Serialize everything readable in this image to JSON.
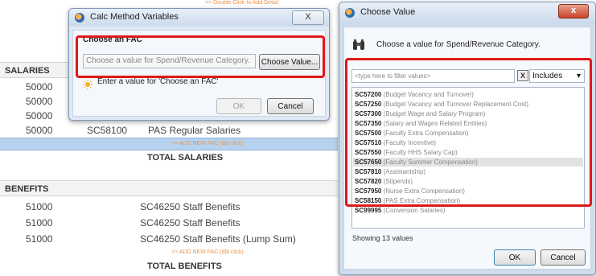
{
  "sheet": {
    "top_hint": ">> Double Click to Add Detail",
    "salaries_header": "SALARIES",
    "salary_rows": [
      {
        "acct": "50000",
        "code": "",
        "desc": ""
      },
      {
        "acct": "50000",
        "code": "",
        "desc": ""
      },
      {
        "acct": "50000",
        "code": "",
        "desc": ""
      },
      {
        "acct": "50000",
        "code": "SC58100",
        "desc": "PAS Regular Salaries"
      }
    ],
    "add_new_fac": ">> ADD NEW FAC (dbl click)",
    "total_salaries": "TOTAL SALARIES",
    "benefits_header": "BENEFITS",
    "benefit_rows": [
      {
        "acct": "51000",
        "text": "SC46250 Staff Benefits"
      },
      {
        "acct": "51000",
        "text": "SC46250 Staff Benefits"
      },
      {
        "acct": "51000",
        "text": "SC46250 Staff Benefits (Lump Sum)"
      }
    ],
    "add_new_fac_2": ">> ADD NEW FAC (dbl click)",
    "total_benefits": "TOTAL BENEFITS"
  },
  "calc_dialog": {
    "title": "Calc Method Variables",
    "close": "X",
    "field_label": "Choose an FAC",
    "field_placeholder": "Choose a value for Spend/Revenue Category.",
    "choose_button": "Choose Value...",
    "hint": "Enter a value for 'Choose an FAC'",
    "ok": "OK",
    "cancel": "Cancel"
  },
  "choose_dialog": {
    "title": "Choose Value",
    "close": "x",
    "instruction": "Choose a value for Spend/Revenue Category.",
    "filter_placeholder": "<type here to filter values>",
    "clear": "X",
    "match_mode": "Includes",
    "items": [
      {
        "code": "SC57200",
        "desc": "(Budget Vacancy and Turnover)"
      },
      {
        "code": "SC57250",
        "desc": "(Budget Vacancy and Turnover Replacement Cost)"
      },
      {
        "code": "SC57300",
        "desc": "(Budget Wage and Salary Program)"
      },
      {
        "code": "SC57350",
        "desc": "(Salary and Wages Related Entities)"
      },
      {
        "code": "SC57500",
        "desc": "(Faculty Extra Compensation)"
      },
      {
        "code": "SC57510",
        "desc": "(Faculty Incentive)"
      },
      {
        "code": "SC57550",
        "desc": "(Faculty HHS Salary Cap)"
      },
      {
        "code": "SC57650",
        "desc": "(Faculty Summer Compensation)"
      },
      {
        "code": "SC57810",
        "desc": "(Assistantship)"
      },
      {
        "code": "SC57820",
        "desc": "(Stipends)"
      },
      {
        "code": "SC57950",
        "desc": "(Nurse Extra Compensation)"
      },
      {
        "code": "SC58150",
        "desc": "(PAS Extra Compensation)"
      },
      {
        "code": "SC99995",
        "desc": "(Conversion Salaries)"
      }
    ],
    "status": "Showing 13 values",
    "ok": "OK",
    "cancel": "Cancel"
  },
  "colors": {
    "highlight_box": "#e01818",
    "selected_row": "#b7d2ee",
    "hint_orange": "#e8954a"
  }
}
